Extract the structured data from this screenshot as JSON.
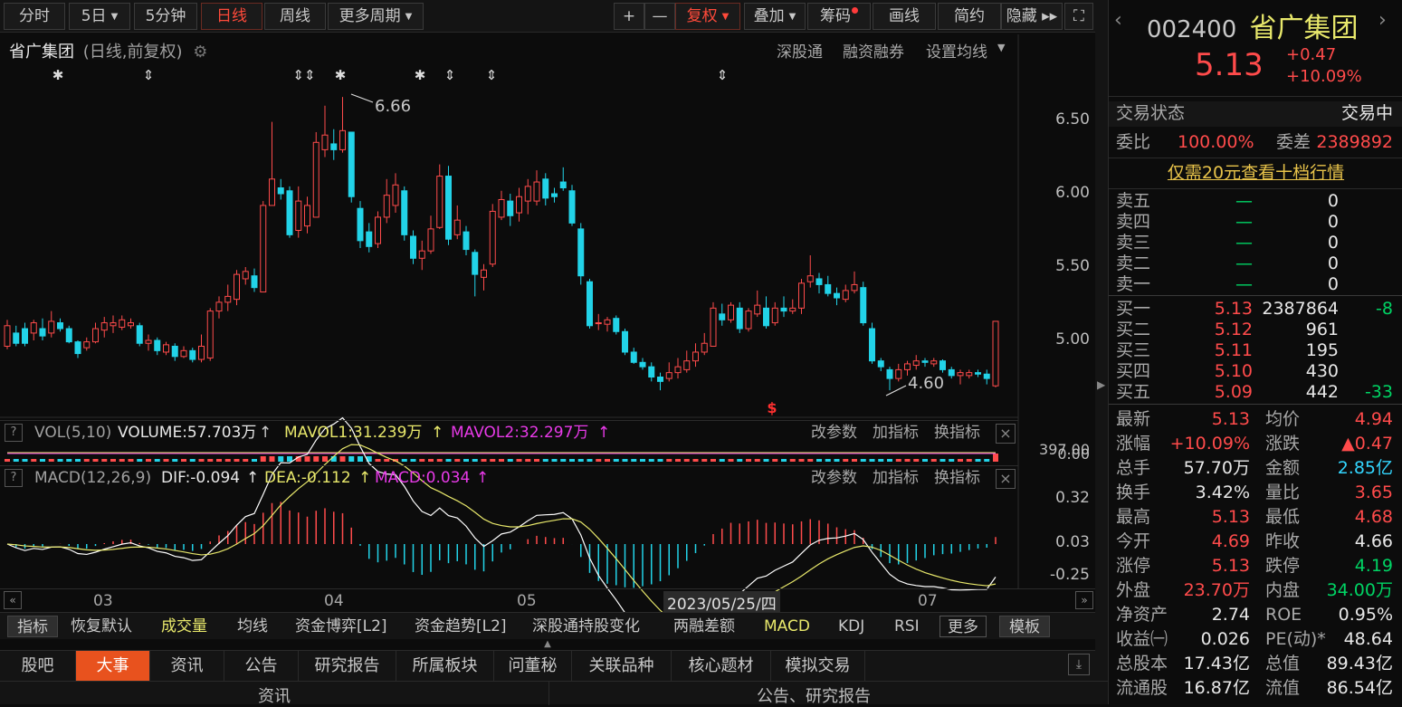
{
  "toolbar": {
    "items": [
      {
        "label": "分时",
        "active": false,
        "caret": false
      },
      {
        "label": "5日",
        "active": false,
        "caret": true
      },
      {
        "label": "5分钟",
        "active": false,
        "caret": false
      },
      {
        "label": "日线",
        "active": true,
        "caret": false
      },
      {
        "label": "周线",
        "active": false,
        "caret": false
      },
      {
        "label": "更多周期",
        "active": false,
        "caret": true
      },
      {
        "label": "+",
        "active": false,
        "caret": false
      },
      {
        "label": "—",
        "active": false,
        "caret": false
      },
      {
        "label": "复权",
        "active": true,
        "caret": true
      },
      {
        "label": "叠加",
        "active": false,
        "caret": true
      },
      {
        "label": "筹码",
        "active": false,
        "caret": false,
        "dot": true
      },
      {
        "label": "画线",
        "active": false,
        "caret": false
      },
      {
        "label": "简约",
        "active": false,
        "caret": false
      },
      {
        "label": "隐藏 ▸▸",
        "active": false,
        "caret": false
      }
    ],
    "fullscreen_icon": "fullscreen-icon"
  },
  "chart_header": {
    "name": "省广集团",
    "mode": "(日线,前复权)",
    "links": [
      "深股通",
      "融资融券",
      "设置均线"
    ]
  },
  "chart_data": {
    "type": "candlestick",
    "ylim": [
      4.6,
      6.7
    ],
    "y_ticks": [
      6.5,
      6.0,
      5.5,
      5.0
    ],
    "x_ticks": [
      "03",
      "04",
      "05",
      "07"
    ],
    "crosshair_date": "2023/05/25/四",
    "high_annotation": "6.66",
    "low_annotation": "4.60",
    "ohlc": [
      [
        4.96,
        5.1,
        5.14,
        4.94
      ],
      [
        5.05,
        4.98,
        5.1,
        4.96
      ],
      [
        5.08,
        4.98,
        5.12,
        4.96
      ],
      [
        5.05,
        5.12,
        5.14,
        5.0
      ],
      [
        5.08,
        5.03,
        5.15,
        5.0
      ],
      [
        5.05,
        5.13,
        5.2,
        5.02
      ],
      [
        5.12,
        5.08,
        5.15,
        5.06
      ],
      [
        5.08,
        4.99,
        5.1,
        4.98
      ],
      [
        4.99,
        4.91,
        5.0,
        4.88
      ],
      [
        4.95,
        4.99,
        5.02,
        4.93
      ],
      [
        4.99,
        5.08,
        5.12,
        4.98
      ],
      [
        5.07,
        5.12,
        5.16,
        5.02
      ],
      [
        5.1,
        5.12,
        5.17,
        5.05
      ],
      [
        5.09,
        5.14,
        5.17,
        5.07
      ],
      [
        5.1,
        5.12,
        5.15,
        5.08
      ],
      [
        5.1,
        4.98,
        5.12,
        4.96
      ],
      [
        4.98,
        5.0,
        5.04,
        4.93
      ],
      [
        5.0,
        4.93,
        5.02,
        4.9
      ],
      [
        4.92,
        4.97,
        4.99,
        4.9
      ],
      [
        4.96,
        4.89,
        4.98,
        4.86
      ],
      [
        4.89,
        4.93,
        4.96,
        4.88
      ],
      [
        4.93,
        4.87,
        4.95,
        4.85
      ],
      [
        4.87,
        4.96,
        5.04,
        4.85
      ],
      [
        4.88,
        5.2,
        5.22,
        4.86
      ],
      [
        5.2,
        5.26,
        5.3,
        5.15
      ],
      [
        5.26,
        5.3,
        5.38,
        5.2
      ],
      [
        5.28,
        5.45,
        5.48,
        5.24
      ],
      [
        5.42,
        5.47,
        5.5,
        5.38
      ],
      [
        5.44,
        5.36,
        5.49,
        5.33
      ],
      [
        5.33,
        5.92,
        5.95,
        5.33
      ],
      [
        5.92,
        6.1,
        6.49,
        5.92
      ],
      [
        6.04,
        6.0,
        6.1,
        5.96
      ],
      [
        6.02,
        5.72,
        6.05,
        5.7
      ],
      [
        5.75,
        5.95,
        6.05,
        5.7
      ],
      [
        5.78,
        5.92,
        5.98,
        5.73
      ],
      [
        5.84,
        6.35,
        6.42,
        5.84
      ],
      [
        6.3,
        6.4,
        6.6,
        6.25
      ],
      [
        6.34,
        6.3,
        6.44,
        6.23
      ],
      [
        6.3,
        6.43,
        6.66,
        6.28
      ],
      [
        6.42,
        5.98,
        6.42,
        5.94
      ],
      [
        5.9,
        5.68,
        5.95,
        5.63
      ],
      [
        5.74,
        5.64,
        5.8,
        5.6
      ],
      [
        5.66,
        5.84,
        5.88,
        5.63
      ],
      [
        5.84,
        5.99,
        6.1,
        5.8
      ],
      [
        5.92,
        6.06,
        6.14,
        5.87
      ],
      [
        6.02,
        5.72,
        6.05,
        5.68
      ],
      [
        5.71,
        5.56,
        5.75,
        5.52
      ],
      [
        5.56,
        5.61,
        5.68,
        5.48
      ],
      [
        5.61,
        5.76,
        5.85,
        5.59
      ],
      [
        5.77,
        6.12,
        6.2,
        5.76
      ],
      [
        6.12,
        5.69,
        6.19,
        5.65
      ],
      [
        5.72,
        5.82,
        5.92,
        5.69
      ],
      [
        5.74,
        5.62,
        5.78,
        5.58
      ],
      [
        5.6,
        5.45,
        5.62,
        5.3
      ],
      [
        5.43,
        5.48,
        5.52,
        5.34
      ],
      [
        5.52,
        5.88,
        5.93,
        5.5
      ],
      [
        5.84,
        5.96,
        6.02,
        5.82
      ],
      [
        5.95,
        5.85,
        6.0,
        5.78
      ],
      [
        5.87,
        5.98,
        6.04,
        5.81
      ],
      [
        5.95,
        6.05,
        6.1,
        5.86
      ],
      [
        5.95,
        6.08,
        6.16,
        5.92
      ],
      [
        6.1,
        5.97,
        6.14,
        5.92
      ],
      [
        6.0,
        5.98,
        6.04,
        5.94
      ],
      [
        6.08,
        6.04,
        6.18,
        6.02
      ],
      [
        6.02,
        5.8,
        6.06,
        5.78
      ],
      [
        5.76,
        5.44,
        5.8,
        5.38
      ],
      [
        5.4,
        5.1,
        5.42,
        5.08
      ],
      [
        5.12,
        5.12,
        5.18,
        5.07
      ],
      [
        5.11,
        5.14,
        5.16,
        5.06
      ],
      [
        5.15,
        5.06,
        5.17,
        5.04
      ],
      [
        5.06,
        4.92,
        5.08,
        4.9
      ],
      [
        4.92,
        4.85,
        4.95,
        4.84
      ],
      [
        4.85,
        4.82,
        4.88,
        4.8
      ],
      [
        4.82,
        4.75,
        4.85,
        4.72
      ],
      [
        4.75,
        4.72,
        4.78,
        4.66
      ],
      [
        4.74,
        4.78,
        4.85,
        4.72
      ],
      [
        4.78,
        4.82,
        4.88,
        4.74
      ],
      [
        4.8,
        4.86,
        4.93,
        4.78
      ],
      [
        4.86,
        4.92,
        4.98,
        4.82
      ],
      [
        4.92,
        4.98,
        5.05,
        4.9
      ],
      [
        4.96,
        5.22,
        5.26,
        4.96
      ],
      [
        5.18,
        5.14,
        5.25,
        5.1
      ],
      [
        5.14,
        5.24,
        5.26,
        5.12
      ],
      [
        5.22,
        5.08,
        5.26,
        5.05
      ],
      [
        5.08,
        5.2,
        5.22,
        5.06
      ],
      [
        5.18,
        5.24,
        5.34,
        5.16
      ],
      [
        5.22,
        5.1,
        5.3,
        5.08
      ],
      [
        5.12,
        5.22,
        5.26,
        5.1
      ],
      [
        5.22,
        5.2,
        5.3,
        5.16
      ],
      [
        5.2,
        5.22,
        5.28,
        5.18
      ],
      [
        5.22,
        5.39,
        5.42,
        5.18
      ],
      [
        5.4,
        5.44,
        5.58,
        5.36
      ],
      [
        5.42,
        5.38,
        5.46,
        5.32
      ],
      [
        5.38,
        5.32,
        5.44,
        5.3
      ],
      [
        5.32,
        5.29,
        5.36,
        5.24
      ],
      [
        5.28,
        5.34,
        5.38,
        5.26
      ],
      [
        5.34,
        5.38,
        5.47,
        5.32
      ],
      [
        5.36,
        5.12,
        5.4,
        5.1
      ],
      [
        5.08,
        4.86,
        5.12,
        4.84
      ],
      [
        4.86,
        4.82,
        4.88,
        4.79
      ],
      [
        4.8,
        4.74,
        4.82,
        4.66
      ],
      [
        4.74,
        4.8,
        4.84,
        4.72
      ],
      [
        4.8,
        4.84,
        4.86,
        4.76
      ],
      [
        4.83,
        4.86,
        4.9,
        4.8
      ],
      [
        4.86,
        4.85,
        4.88,
        4.82
      ],
      [
        4.84,
        4.86,
        4.88,
        4.82
      ],
      [
        4.86,
        4.8,
        4.87,
        4.78
      ],
      [
        4.8,
        4.76,
        4.82,
        4.74
      ],
      [
        4.76,
        4.78,
        4.8,
        4.7
      ],
      [
        4.76,
        4.78,
        4.8,
        4.74
      ],
      [
        4.78,
        4.77,
        4.8,
        4.75
      ],
      [
        4.77,
        4.74,
        4.8,
        4.7
      ],
      [
        4.69,
        5.13,
        5.13,
        4.68
      ]
    ]
  },
  "vol": {
    "label": "VOL(5,10)",
    "volume": "VOLUME:57.703万",
    "mavol1": "MAVOL1:31.239万",
    "mavol2": "MAVOL2:32.297万",
    "axis_top": "397.00",
    "axis_bottom": "0.00",
    "buttons": [
      "改参数",
      "加指标",
      "换指标"
    ]
  },
  "macd": {
    "label": "MACD(12,26,9)",
    "dif": "DIF:-0.094",
    "dea": "DEA:-0.112",
    "macd": "MACD:0.034",
    "axis": [
      "0.32",
      "0.03",
      "-0.25"
    ],
    "buttons": [
      "改参数",
      "加指标",
      "换指标"
    ]
  },
  "indicator_bar": [
    "指标",
    "恢复默认",
    "成交量",
    "均线",
    "资金博弈[L2]",
    "资金趋势[L2]",
    "深股通持股变化",
    "两融差额",
    "MACD",
    "KDJ",
    "RSI",
    "更多",
    "模板"
  ],
  "tabs": [
    "股吧",
    "大事",
    "资讯",
    "公告",
    "研究报告",
    "所属板块",
    "问董秘",
    "关联品种",
    "核心题材",
    "模拟交易"
  ],
  "bottom": {
    "left": "资讯",
    "right": "公告、研究报告"
  },
  "quote": {
    "code": "002400",
    "name": "省广集团",
    "price": "5.13",
    "change": "+0.47",
    "pct": "+10.09%",
    "status_label": "交易状态",
    "status": "交易中",
    "weibi_label": "委比",
    "weibi": "100.00%",
    "weicha_label": "委差",
    "weicha": "2389892",
    "promo": "仅需20元查看十档行情",
    "asks": [
      {
        "label": "卖五",
        "price": "—",
        "vol": "0"
      },
      {
        "label": "卖四",
        "price": "—",
        "vol": "0"
      },
      {
        "label": "卖三",
        "price": "—",
        "vol": "0"
      },
      {
        "label": "卖二",
        "price": "—",
        "vol": "0"
      },
      {
        "label": "卖一",
        "price": "—",
        "vol": "0"
      }
    ],
    "bids": [
      {
        "label": "买一",
        "price": "5.13",
        "vol": "2387864",
        "chg": "-8"
      },
      {
        "label": "买二",
        "price": "5.12",
        "vol": "961",
        "chg": ""
      },
      {
        "label": "买三",
        "price": "5.11",
        "vol": "195",
        "chg": ""
      },
      {
        "label": "买四",
        "price": "5.10",
        "vol": "430",
        "chg": ""
      },
      {
        "label": "买五",
        "price": "5.09",
        "vol": "442",
        "chg": "-33"
      }
    ],
    "stats": [
      {
        "l1": "最新",
        "v1": "5.13",
        "c1": "red",
        "l2": "均价",
        "v2": "4.94",
        "c2": "red"
      },
      {
        "l1": "涨幅",
        "v1": "+10.09%",
        "c1": "red",
        "l2": "涨跌",
        "v2": "▲0.47",
        "c2": "red"
      },
      {
        "l1": "总手",
        "v1": "57.70万",
        "c1": "white",
        "l2": "金额",
        "v2": "2.85亿",
        "c2": "cyan"
      },
      {
        "l1": "换手",
        "v1": "3.42%",
        "c1": "white",
        "l2": "量比",
        "v2": "3.65",
        "c2": "red"
      },
      {
        "l1": "最高",
        "v1": "5.13",
        "c1": "red",
        "l2": "最低",
        "v2": "4.68",
        "c2": "red"
      },
      {
        "l1": "今开",
        "v1": "4.69",
        "c1": "red",
        "l2": "昨收",
        "v2": "4.66",
        "c2": "white"
      },
      {
        "l1": "涨停",
        "v1": "5.13",
        "c1": "red",
        "l2": "跌停",
        "v2": "4.19",
        "c2": "green"
      },
      {
        "l1": "外盘",
        "v1": "23.70万",
        "c1": "red",
        "l2": "内盘",
        "v2": "34.00万",
        "c2": "green"
      },
      {
        "l1": "净资产",
        "v1": "2.74",
        "c1": "white",
        "l2": "ROE",
        "v2": "0.95%",
        "c2": "white"
      },
      {
        "l1": "收益㈠",
        "v1": "0.026",
        "c1": "white",
        "l2": "PE(动)*",
        "v2": "48.64",
        "c2": "white"
      },
      {
        "l1": "总股本",
        "v1": "17.43亿",
        "c1": "white",
        "l2": "总值",
        "v2": "89.43亿",
        "c2": "white"
      },
      {
        "l1": "流通股",
        "v1": "16.87亿",
        "c1": "white",
        "l2": "流值",
        "v2": "86.54亿",
        "c2": "white"
      }
    ]
  },
  "colors": {
    "up": "#ff4b4b",
    "down": "#22d3e8",
    "bg": "#0c0c0c"
  }
}
